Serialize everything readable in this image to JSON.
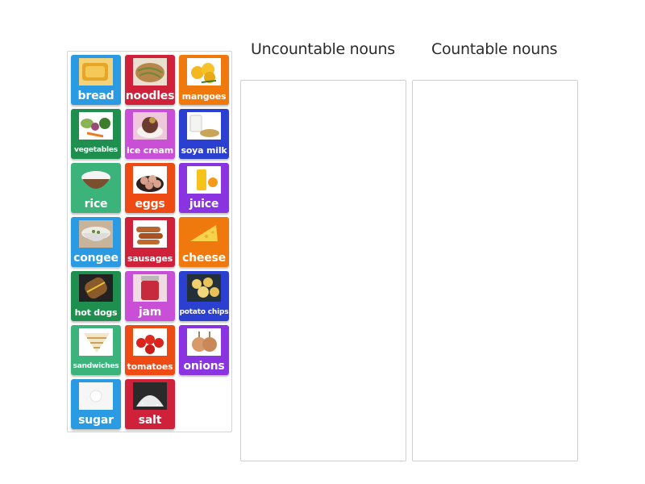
{
  "columns": [
    {
      "title": "Uncountable nouns",
      "items": []
    },
    {
      "title": "Countable nouns",
      "items": []
    }
  ],
  "tiles": [
    {
      "label": "bread",
      "color": "#2a9be3",
      "icon": "bread-image",
      "size": "l"
    },
    {
      "label": "noodles",
      "color": "#d0213a",
      "icon": "noodles-image",
      "size": "l"
    },
    {
      "label": "mangoes",
      "color": "#f0790e",
      "icon": "mangoes-image",
      "size": "m"
    },
    {
      "label": "vegetables",
      "color": "#1f8f4f",
      "icon": "vegetables-image",
      "size": "s"
    },
    {
      "label": "ice cream",
      "color": "#c84fd6",
      "icon": "ice-cream-image",
      "size": "m"
    },
    {
      "label": "soya milk",
      "color": "#2b3fd1",
      "icon": "soya-milk-image",
      "size": "m"
    },
    {
      "label": "rice",
      "color": "#3bb37a",
      "icon": "rice-image",
      "size": "l"
    },
    {
      "label": "eggs",
      "color": "#ee4a14",
      "icon": "eggs-image",
      "size": "l"
    },
    {
      "label": "juice",
      "color": "#8a33e0",
      "icon": "juice-image",
      "size": "l"
    },
    {
      "label": "congee",
      "color": "#2a9be3",
      "icon": "congee-image",
      "size": "l"
    },
    {
      "label": "sausages",
      "color": "#d0213a",
      "icon": "sausages-image",
      "size": "m"
    },
    {
      "label": "cheese",
      "color": "#f0790e",
      "icon": "cheese-image",
      "size": "l"
    },
    {
      "label": "hot dogs",
      "color": "#1f8f4f",
      "icon": "hot-dogs-image",
      "size": "m"
    },
    {
      "label": "jam",
      "color": "#c84fd6",
      "icon": "jam-image",
      "size": "l"
    },
    {
      "label": "potato chips",
      "color": "#2b3fd1",
      "icon": "potato-chips-image",
      "size": "s"
    },
    {
      "label": "sandwiches",
      "color": "#3bb37a",
      "icon": "sandwiches-image",
      "size": "s"
    },
    {
      "label": "tomatoes",
      "color": "#ee4a14",
      "icon": "tomatoes-image",
      "size": "m"
    },
    {
      "label": "onions",
      "color": "#8a33e0",
      "icon": "onions-image",
      "size": "l"
    },
    {
      "label": "sugar",
      "color": "#2a9be3",
      "icon": "sugar-image",
      "size": "l"
    },
    {
      "label": "salt",
      "color": "#d0213a",
      "icon": "salt-image",
      "size": "l"
    }
  ]
}
